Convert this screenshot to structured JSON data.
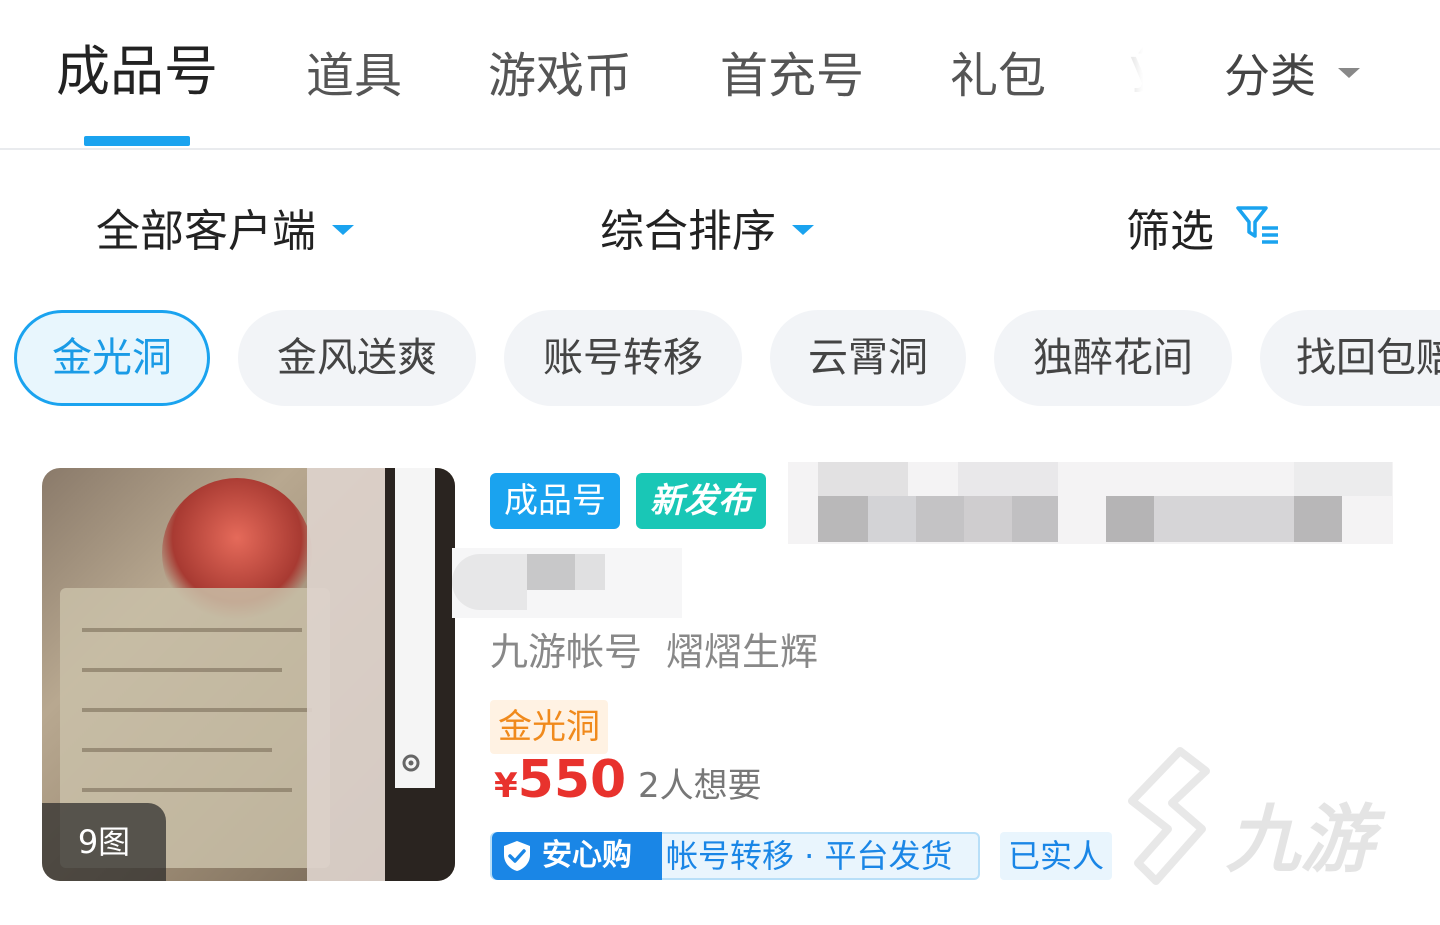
{
  "tabs": {
    "items": [
      {
        "label": "成品号",
        "active": true
      },
      {
        "label": "道具"
      },
      {
        "label": "游戏币"
      },
      {
        "label": "首充号"
      },
      {
        "label": "礼包"
      },
      {
        "label": "Ӳ"
      }
    ],
    "category_label": "分类",
    "accent": "#1aa3ef"
  },
  "filters": {
    "client": "全部客户端",
    "sort": "综合排序",
    "screen": "筛选"
  },
  "chips": [
    "金光洞",
    "金风送爽",
    "账号转移",
    "云霄洞",
    "独醉花间",
    "找回包赔"
  ],
  "listing": {
    "image_count": "9图",
    "type_badge": "成品号",
    "new_badge": "新发布",
    "seller": "九游帐号",
    "seller_level": "熠熠生辉",
    "area": "金光洞",
    "currency": "¥",
    "price": "550",
    "wanted": "2人想要",
    "guarantee_brand": "安心购",
    "guarantee_text": "帐号转移 · 平台发货",
    "verified": "已实人",
    "price_color": "#e8322d"
  },
  "watermark": {
    "text": "九游"
  }
}
